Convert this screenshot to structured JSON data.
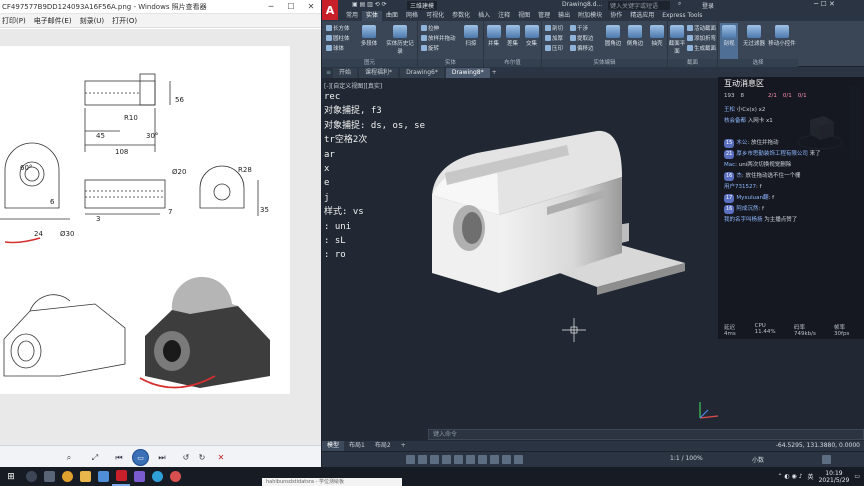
{
  "viewer": {
    "title": "CF497577B9DD124093A16F56A.png - Windows 照片查看器",
    "menu": [
      "打印(P)",
      "电子邮件(E)",
      "刻录(U)",
      "打开(O)"
    ],
    "drawing_labels": {
      "dim_56": "56",
      "r10": "R10",
      "dim_45": "45",
      "angle_30": "30°",
      "dim_108": "108",
      "angle_60": "60°",
      "phi20": "Ø20",
      "r28": "R28",
      "dim_6": "6",
      "dim_3": "3",
      "dim_7": "7",
      "dim_24": "24",
      "phi30": "Ø30",
      "dim_35": "35"
    }
  },
  "cad": {
    "app_letter": "A",
    "workspace": "三维建模",
    "doc_title": "Drawing8.d...",
    "search_placeholder": "键入关键字或短语",
    "user": "登录",
    "ribbon_tabs": [
      "常用",
      "实体",
      "曲面",
      "网格",
      "可视化",
      "参数化",
      "插入",
      "注释",
      "视图",
      "管理",
      "输出",
      "附加模块",
      "协作",
      "精选应用",
      "Express Tools"
    ],
    "active_ribbon_tab": "实体",
    "groups": {
      "primitive": {
        "label": "图元",
        "items": [
          "长方体",
          "圆柱体",
          "球体"
        ],
        "big": [
          "多段体",
          "实体历史记录"
        ]
      },
      "solid": {
        "label": "实体",
        "items": [
          "拉伸",
          "放样并拖动",
          "旋转"
        ],
        "big": [
          "扫掠"
        ]
      },
      "boolean": {
        "label": "布尔值",
        "big": [
          "并集",
          "差集",
          "交集"
        ]
      },
      "solid_edit": {
        "label": "实体编辑",
        "items": [
          "剖切",
          "干涉",
          "加厚",
          "提取边",
          "压印",
          "偏移边"
        ],
        "big": [
          "圆角边",
          "倒角边",
          "抽壳"
        ]
      },
      "section": {
        "label": "截面",
        "big": [
          "截面平面"
        ],
        "items": [
          "活动截面",
          "添加折弯",
          "生成截面"
        ]
      },
      "selection": {
        "label": "选择",
        "big": [
          "剖视",
          "无过滤器",
          "移动小控件"
        ]
      }
    },
    "doc_tabs": [
      "开始",
      "课程福利*",
      "Drawing6*",
      "Drawing8*"
    ],
    "active_doc_tab": "Drawing8*",
    "viewport_label": "[-][自定义视图][真实]",
    "command_history": [
      "rec",
      "对象捕捉, f3",
      "对象捕捉: ds, os, se",
      "tr空格2次",
      "ar",
      "x",
      "e",
      "j",
      "样式: vs",
      ": uni",
      ": sL",
      ": ro"
    ],
    "command_prompt": "键入命令",
    "layout_tabs": [
      "模型",
      "布局1",
      "布局2"
    ],
    "active_layout": "模型",
    "coords": "-64.5295, 131.3880, 0.0000",
    "status_mode": "小数",
    "status_scale": "1:1 / 100%"
  },
  "chat": {
    "title": "互动消息区",
    "stats": {
      "viewers": "193",
      "likes": "8",
      "gift1": "2/1",
      "gift2": "0/1",
      "gift3": "0/1"
    },
    "messages": [
      {
        "user": "王松",
        "text": "小Cx(x)  x2",
        "level": ""
      },
      {
        "user": "核会备都",
        "text": "入网卡  x1",
        "level": ""
      },
      {
        "user": "",
        "text": "",
        "level": ""
      },
      {
        "user": "木公",
        "text": "放住并拖动",
        "level": "15"
      },
      {
        "user": "厚乡市思勤装饰工程有限公司",
        "text": "来了",
        "level": "21"
      },
      {
        "user": "Mac",
        "text": "uni两次切换视觉删除",
        "level": ""
      },
      {
        "user": "杰",
        "text": "放住拖动选不住一个栅",
        "level": "16"
      },
      {
        "user": "用户731527",
        "text": "f",
        "level": ""
      },
      {
        "user": "Myxuluan翻",
        "text": "f",
        "level": "17"
      },
      {
        "user": "阿成沉然",
        "text": "f",
        "level": "16"
      },
      {
        "user": "我的名字叫杨扬",
        "text": "为主播点赞了",
        "level": ""
      }
    ],
    "latency": "延迟 4ms",
    "cpu": "CPU 11.44%",
    "bitrate": "码率 749kb/s",
    "fps": "帧率 30fps"
  },
  "taskbar": {
    "lang": "英",
    "time": "10:19",
    "date": "2021/5/29",
    "toast": "hahibunsdstidatsra - 学位测绘板"
  }
}
